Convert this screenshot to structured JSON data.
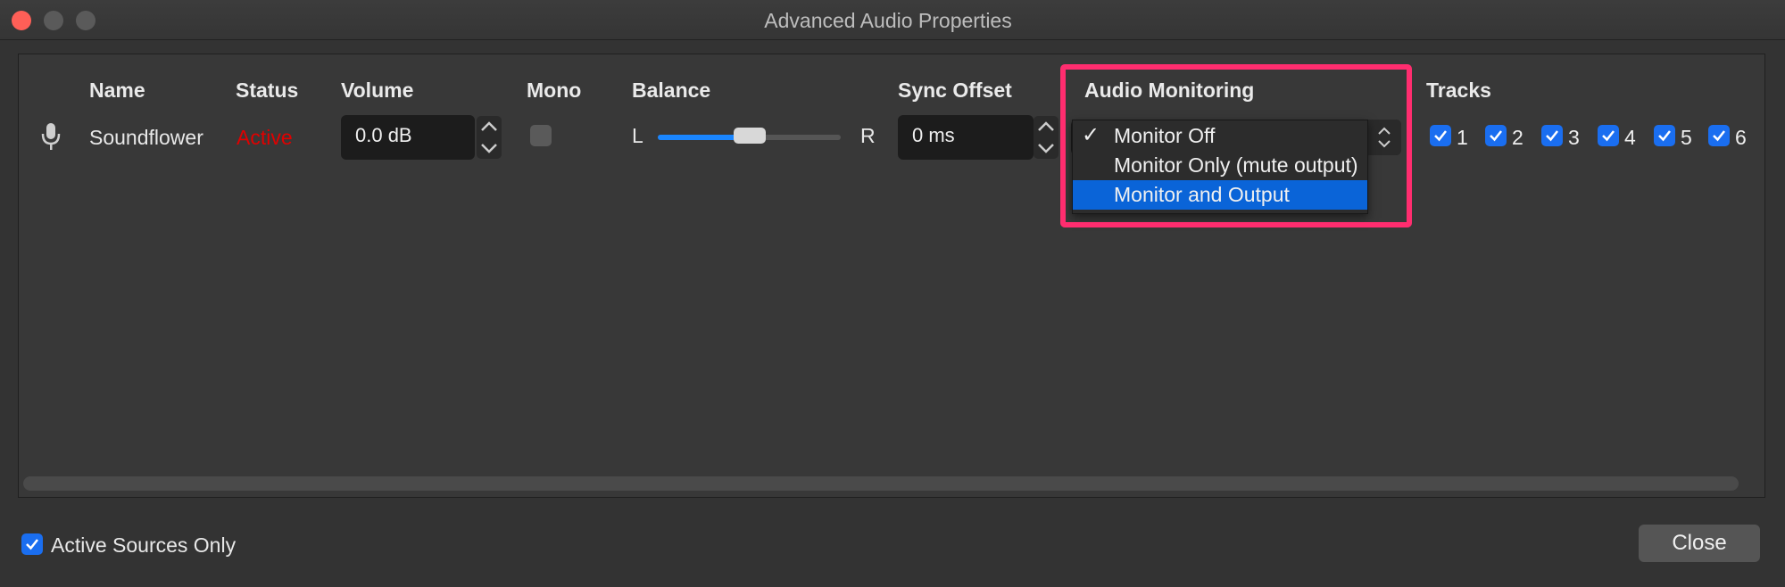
{
  "window": {
    "title": "Advanced Audio Properties"
  },
  "columns": {
    "name": "Name",
    "status": "Status",
    "volume": "Volume",
    "mono": "Mono",
    "balance": "Balance",
    "sync_offset": "Sync Offset",
    "audio_monitoring": "Audio Monitoring",
    "tracks": "Tracks"
  },
  "row": {
    "icon": "microphone-icon",
    "name": "Soundflower",
    "status": "Active",
    "volume": "0.0 dB",
    "mono_checked": false,
    "balance_left": "L",
    "balance_right": "R",
    "balance_value": 0.5,
    "sync_offset": "0 ms"
  },
  "monitoring_dropdown": {
    "options": [
      {
        "label": "Monitor Off",
        "checked": true,
        "highlighted": false
      },
      {
        "label": "Monitor Only (mute output)",
        "checked": false,
        "highlighted": false
      },
      {
        "label": "Monitor and Output",
        "checked": false,
        "highlighted": true
      }
    ]
  },
  "tracks": [
    {
      "label": "1",
      "checked": true
    },
    {
      "label": "2",
      "checked": true
    },
    {
      "label": "3",
      "checked": true
    },
    {
      "label": "4",
      "checked": true
    },
    {
      "label": "5",
      "checked": true
    },
    {
      "label": "6",
      "checked": true
    }
  ],
  "footer": {
    "active_sources_only": "Active Sources Only",
    "active_sources_checked": true,
    "close": "Close"
  },
  "colors": {
    "accent": "#1a6ef0",
    "status_active": "#e00000",
    "highlight_box": "#ff2d6f",
    "selected_option": "#0a64d8"
  }
}
